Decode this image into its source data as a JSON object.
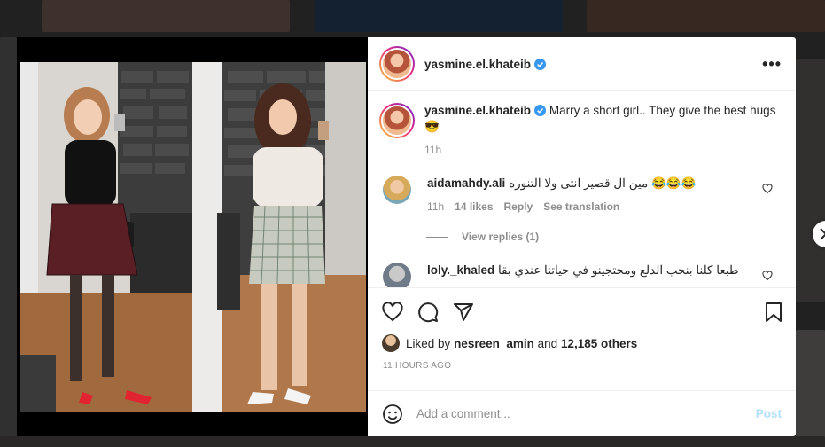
{
  "post": {
    "username": "yasmine.el.khateib",
    "caption": "Marry a short girl.. They give the best hugs 😎",
    "caption_time": "11h",
    "more_label": "•••"
  },
  "comments": [
    {
      "username": "aidamahdy.ali",
      "text": "مين ال قصير انتى ولا التنوره 😂😂😂",
      "time": "11h",
      "likes": "14 likes",
      "reply": "Reply",
      "translate": "See translation",
      "view_replies": "View replies (1)"
    },
    {
      "username": "loly._khaled",
      "text": "طبعا كلنا بنحب الدلع ومحتجينو في حياتنا عندي بقا"
    }
  ],
  "likes": {
    "prefix": "Liked by",
    "user": "nesreen_amin",
    "and": "and",
    "others": "12,185 others"
  },
  "posted_ago": "11 HOURS AGO",
  "add_comment": {
    "placeholder": "Add a comment...",
    "post_label": "Post"
  },
  "icons": [
    "heart-icon",
    "comment-icon",
    "share-icon",
    "bookmark-icon",
    "emoji-icon",
    "verified-icon",
    "chevron-right-icon",
    "more-icon"
  ],
  "colors": {
    "verified": "#3897f0",
    "post_disabled": "#b2dffc",
    "muted": "#8e8e8e",
    "text": "#262626"
  }
}
